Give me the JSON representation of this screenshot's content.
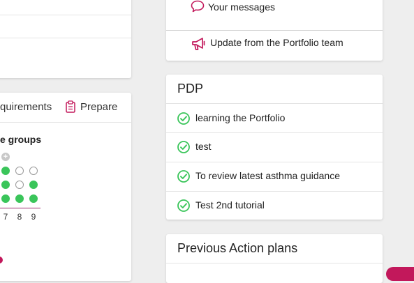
{
  "colors": {
    "accent": "#c2185b",
    "success": "#3ac55a",
    "divider": "#e4e4e4"
  },
  "left_panel": {
    "tabs": {
      "requirements_label": "quirements",
      "prepare_label": "Prepare"
    },
    "groups_title": "e groups",
    "dots": [
      [
        "add",
        null,
        null
      ],
      [
        "filled",
        "empty",
        "empty"
      ],
      [
        "filled",
        "empty",
        "filled"
      ],
      [
        "filled",
        "filled",
        "filled"
      ]
    ],
    "column_numbers": [
      "7",
      "8",
      "9"
    ]
  },
  "notifications": {
    "messages_label": "Your messages",
    "update_label": "Update from the Portfolio team"
  },
  "pdp": {
    "title": "PDP",
    "items": [
      {
        "label": "learning the Portfolio"
      },
      {
        "label": "test"
      },
      {
        "label": "To review latest asthma guidance"
      },
      {
        "label": "Test 2nd tutorial"
      }
    ]
  },
  "previous_action_plans": {
    "title": "Previous Action plans"
  }
}
